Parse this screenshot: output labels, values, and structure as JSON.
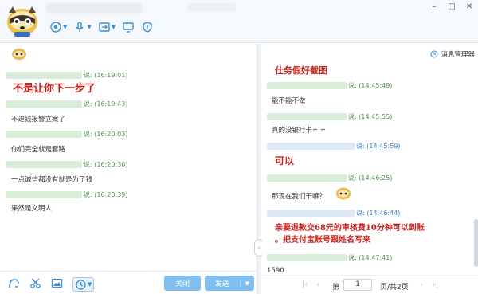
{
  "left_messages": [
    {
      "time": "说: (16:19:01)",
      "text": ""
    },
    {
      "time": "说: (16:19:43)",
      "text": "不退钱报警立案了"
    },
    {
      "time": "说: (16:20:03)",
      "text": "你们完全就是套路"
    },
    {
      "time": "说: (16:20:30)",
      "text": "一点诚信都没有就是为了钱"
    },
    {
      "time": "说: (16:20:39)",
      "text": "果然是文明人"
    }
  ],
  "left_overlay": "不是让你下一步了",
  "right_messages": [
    {
      "time": "说: (14:45:49)",
      "text": "能不能不做"
    },
    {
      "time": "说: (14:45:55)",
      "text": "真的没银行卡= ="
    },
    {
      "time": "说: (14:45:59)",
      "text": ""
    },
    {
      "time": "说: (14:46:25)",
      "text": "那现在我们干嘛？"
    },
    {
      "time": "说: (14:46:44)",
      "text": ""
    },
    {
      "time": "说: (14:47:41)",
      "text": "1590"
    }
  ],
  "right_overlays": {
    "title": "仕务假好截图",
    "reply1": "可以",
    "reply2_line1": "亲要退款交68元的审核费10分钟可以到账",
    "reply2_line2": "。把支付宝账号跟姓名写来"
  },
  "message_manager": "消息管理器",
  "buttons": {
    "close": "关闭",
    "send": "发送"
  },
  "pager": {
    "page_label": "第",
    "page": "1",
    "total": "页/共2页"
  },
  "window_controls": {
    "min": "–",
    "max": "□",
    "close": "✕"
  },
  "icons": [
    "raccoon-avatar-icon",
    "voice-call-icon",
    "microphone-icon",
    "file-transfer-icon",
    "screen-share-icon",
    "shield-icon",
    "clock-icon",
    "scissors-icon",
    "image-icon",
    "emoji-icon"
  ]
}
